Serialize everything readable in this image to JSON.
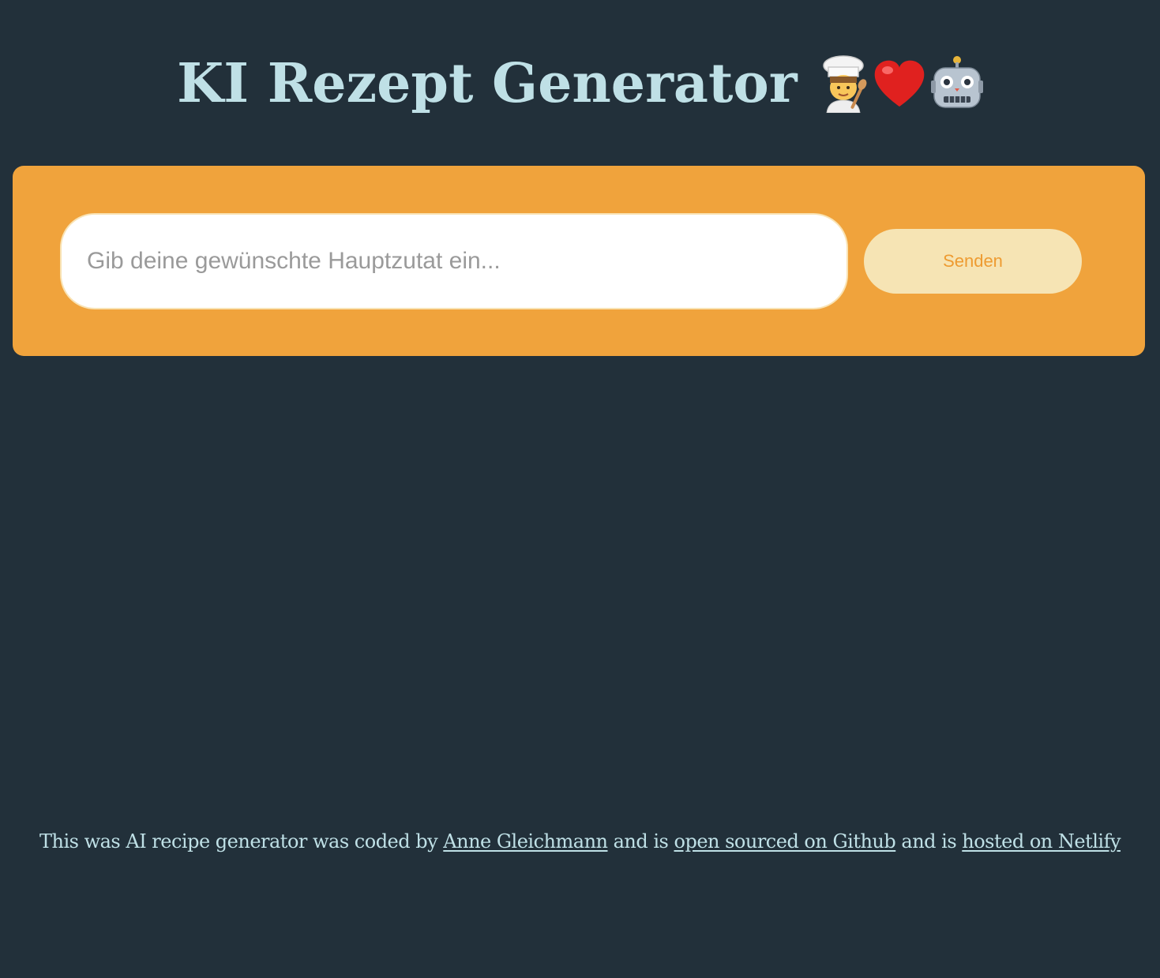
{
  "header": {
    "title": "KI Rezept Generator",
    "icons": [
      "chef-icon",
      "heart-icon",
      "robot-icon"
    ]
  },
  "form": {
    "placeholder": "Gib deine gewünschte Hauptzutat ein...",
    "value": "",
    "submit_label": "Senden"
  },
  "footer": {
    "text_1": "This was AI recipe generator was coded by ",
    "author_link": "Anne Gleichmann",
    "text_2": " and is ",
    "github_link": "open sourced on Github",
    "text_3": " and is ",
    "netlify_link": "hosted on Netlify"
  },
  "colors": {
    "background": "#22303a",
    "title": "#bfe0e6",
    "panel": "#f0a33c",
    "button_bg": "#f6e4b4",
    "button_text": "#ee9b31"
  }
}
